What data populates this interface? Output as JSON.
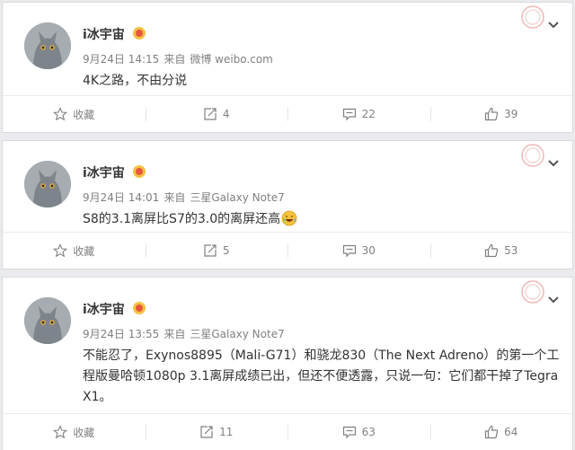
{
  "posts": [
    {
      "username": "i冰宇宙",
      "time": "9月24日 14:15",
      "via": "来自",
      "source": "微博 weibo.com",
      "text": "4K之路，不由分说",
      "favorite_label": "收藏",
      "reposts": "4",
      "comments": "22",
      "likes": "39"
    },
    {
      "username": "i冰宇宙",
      "time": "9月24日 14:01",
      "via": "来自",
      "source": "三星Galaxy Note7",
      "text": "S8的3.1离屏比S7的3.0的离屏还高",
      "favorite_label": "收藏",
      "reposts": "5",
      "comments": "30",
      "likes": "53"
    },
    {
      "username": "i冰宇宙",
      "time": "9月24日 13:55",
      "via": "来自",
      "source": "三星Galaxy Note7",
      "text": "不能忍了，Exynos8895（Mali-G71）和骁龙830（The Next Adreno）的第一个工程版曼哈顿1080p 3.1离屏成绩已出，但还不便透露，只说一句：它们都干掉了Tegra X1。",
      "favorite_label": "收藏",
      "reposts": "11",
      "comments": "63",
      "likes": "64"
    }
  ]
}
